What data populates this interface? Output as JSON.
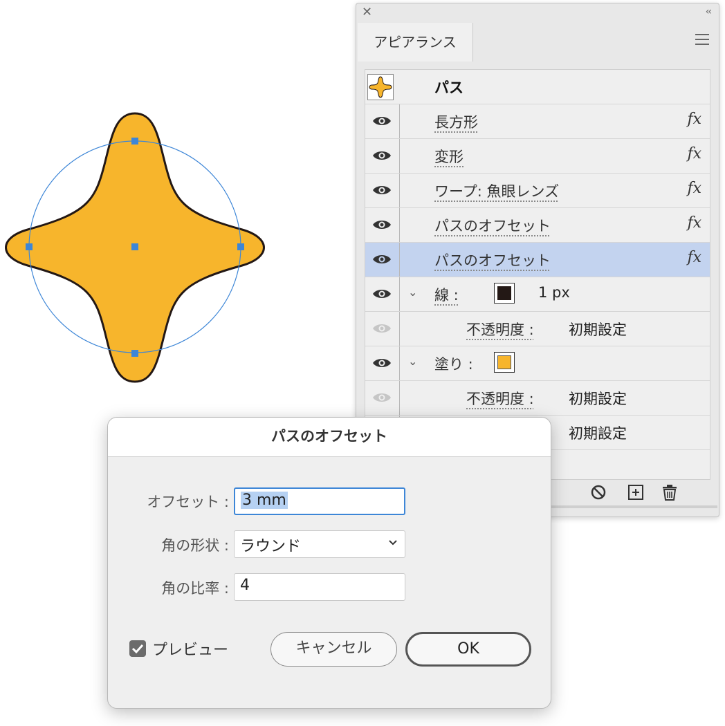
{
  "panel": {
    "title": "アピアランス",
    "object_label": "パス",
    "effects": [
      {
        "label": "長方形",
        "fx": "fx"
      },
      {
        "label": "変形",
        "fx": "fx"
      },
      {
        "label": "ワープ: 魚眼レンズ",
        "fx": "fx"
      },
      {
        "label": "パスのオフセット",
        "fx": "fx"
      },
      {
        "label": "パスのオフセット",
        "fx": "fx",
        "selected": true
      }
    ],
    "stroke": {
      "label": "線 :",
      "value": "1 px",
      "color": "#231815"
    },
    "stroke_opacity": {
      "label": "不透明度 :",
      "value": "初期設定"
    },
    "fill": {
      "label": "塗り :",
      "color": "#f7b52c"
    },
    "fill_opacity": {
      "label": "不透明度 :",
      "value": "初期設定"
    },
    "object_opacity": {
      "value": "初期設定"
    }
  },
  "dialog": {
    "title": "パスのオフセット",
    "offset_label": "オフセット :",
    "offset_value": "3 mm",
    "corner_label": "角の形状 :",
    "corner_value": "ラウンド",
    "miter_label": "角の比率 :",
    "miter_value": "4",
    "preview_label": "プレビュー",
    "preview_checked": true,
    "cancel_label": "キャンセル",
    "ok_label": "OK"
  },
  "colors": {
    "shape_fill": "#f7b52c",
    "shape_stroke": "#231815",
    "selection": "#3d86d7",
    "selected_row": "#c3d3ef"
  }
}
